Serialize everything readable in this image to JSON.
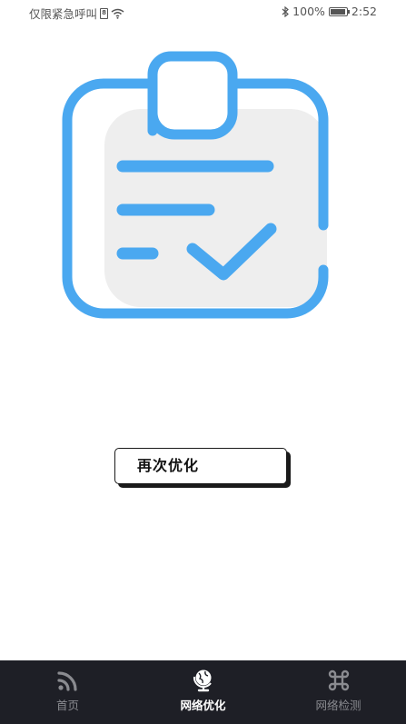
{
  "status_bar": {
    "carrier": "仅限紧急呼叫",
    "sim_label": "8",
    "battery_percent": "100%",
    "time": "2:52",
    "icons": [
      "sim-icon",
      "wifi-icon",
      "bluetooth-icon",
      "battery-icon"
    ]
  },
  "illustration": {
    "icon": "clipboard-check-icon",
    "accent_color": "#4aa8f0",
    "fill_color": "#eeeeee"
  },
  "main": {
    "button_label": "再次优化"
  },
  "tab_bar": {
    "background": "#1e1f26",
    "tabs": [
      {
        "label": "首页",
        "icon": "rss-icon",
        "active": false
      },
      {
        "label": "网络优化",
        "icon": "globe-icon",
        "active": true
      },
      {
        "label": "网络检测",
        "icon": "command-icon",
        "active": false
      }
    ]
  }
}
